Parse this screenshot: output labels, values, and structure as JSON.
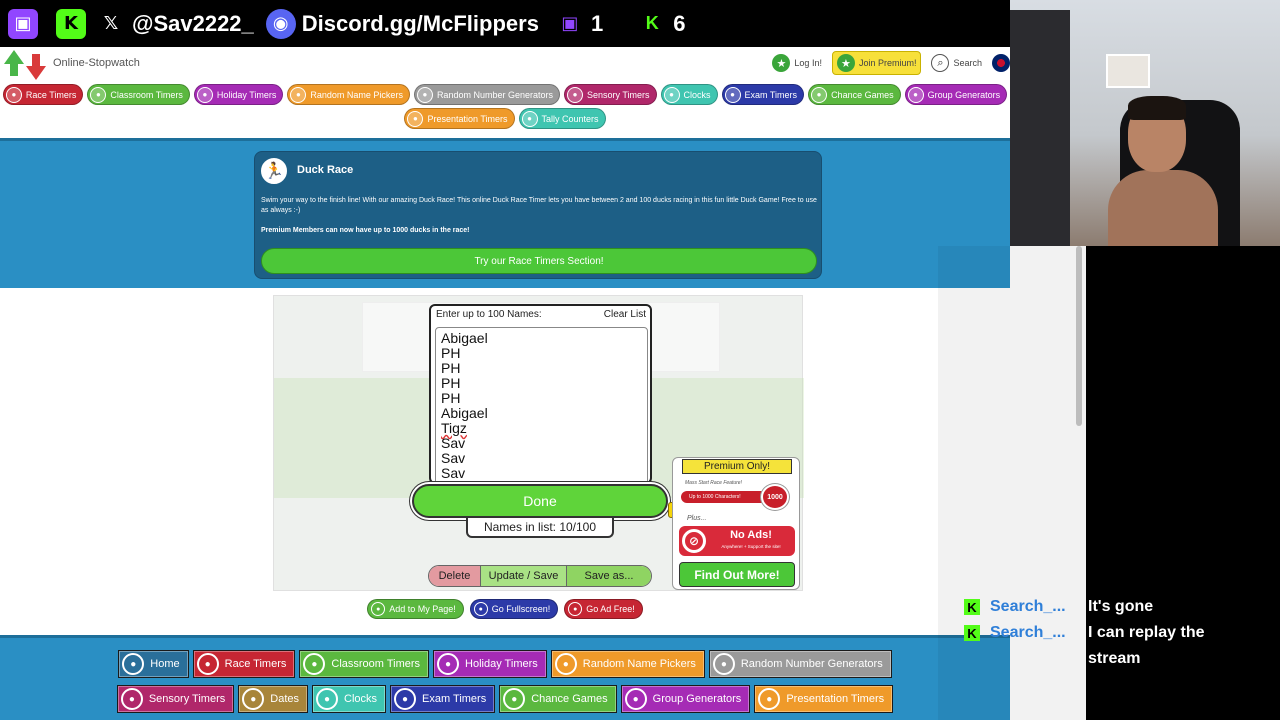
{
  "overlay": {
    "x_handle": "@Sav2222_",
    "discord": "Discord.gg/McFlippers",
    "twitch_count": "1",
    "kick_count": "6"
  },
  "site": {
    "name": "Online-Stopwatch",
    "login": "Log In!",
    "join_premium": "Join Premium!",
    "search": "Search",
    "nav_row1": [
      {
        "label": "Race Timers",
        "color": "#c62633"
      },
      {
        "label": "Classroom Timers",
        "color": "#5bb83f"
      },
      {
        "label": "Holiday Timers",
        "color": "#a52bb5"
      },
      {
        "label": "Random Name Pickers",
        "color": "#ef9a2a"
      },
      {
        "label": "Random Number Generators",
        "color": "#9a9a9a"
      },
      {
        "label": "Sensory Timers",
        "color": "#b0276a"
      },
      {
        "label": "Clocks",
        "color": "#3fc5b0"
      },
      {
        "label": "Exam Timers",
        "color": "#2c3aa8"
      },
      {
        "label": "Chance Games",
        "color": "#5bb83f"
      },
      {
        "label": "Group Generators",
        "color": "#a52bb5"
      }
    ],
    "nav_row2": [
      {
        "label": "Presentation Timers",
        "color": "#ef9a2a"
      },
      {
        "label": "Tally Counters",
        "color": "#3fc5b0"
      }
    ],
    "hero": {
      "title": "Duck Race",
      "description": "Swim your way to the finish line! With our amazing Duck Race! This online Duck Race Timer lets you have between 2 and 100 ducks racing in this fun little Duck Game! Free to use as always :-)",
      "premium_note": "Premium Members can now have up to 1000 ducks in the race!",
      "cta": "Try our Race Timers Section!"
    },
    "names_panel": {
      "label": "Enter up to 100 Names:",
      "clear": "Clear List",
      "names": [
        "Abigael",
        "PH",
        "PH",
        "PH",
        "PH",
        "Abigael",
        "Tigz",
        "Sav",
        "Sav",
        "Sav"
      ],
      "done": "Done",
      "count": "Names in list: 10/100"
    },
    "premium_box": {
      "header": "Premium Only!",
      "mass_start": "Mass Start Race Feature!",
      "bar": "Up to 1000 Characters!",
      "badge": "1000",
      "plus": "Plus...",
      "no_ads": "No Ads!",
      "no_ads_sub": "Anywhere! + Support the site!",
      "find_out": "Find Out More!"
    },
    "edit_row": {
      "delete": "Delete",
      "update": "Update / Save",
      "save_as": "Save as..."
    },
    "actions": [
      {
        "label": "Add to My Page!",
        "color": "#5bb83f"
      },
      {
        "label": "Go Fullscreen!",
        "color": "#2c3aa8"
      },
      {
        "label": "Go Ad Free!",
        "color": "#c62633"
      }
    ],
    "footer_row1": [
      {
        "label": "Home",
        "color": "#2a6f9a"
      },
      {
        "label": "Race Timers",
        "color": "#c62633"
      },
      {
        "label": "Classroom Timers",
        "color": "#5bb83f"
      },
      {
        "label": "Holiday Timers",
        "color": "#a52bb5"
      },
      {
        "label": "Random Name Pickers",
        "color": "#ef9a2a"
      },
      {
        "label": "Random Number Generators",
        "color": "#9a9a9a"
      }
    ],
    "footer_row2": [
      {
        "label": "Sensory Timers",
        "color": "#b0276a"
      },
      {
        "label": "Dates",
        "color": "#a8853a"
      },
      {
        "label": "Clocks",
        "color": "#3fc5b0"
      },
      {
        "label": "Exam Timers",
        "color": "#2c3aa8"
      },
      {
        "label": "Chance Games",
        "color": "#5bb83f"
      },
      {
        "label": "Group Generators",
        "color": "#a52bb5"
      },
      {
        "label": "Presentation Timers",
        "color": "#ef9a2a"
      }
    ]
  },
  "chat": [
    {
      "user": "Search_...",
      "text": "It's gone"
    },
    {
      "user": "Search_...",
      "text": "I can replay the stream"
    }
  ]
}
